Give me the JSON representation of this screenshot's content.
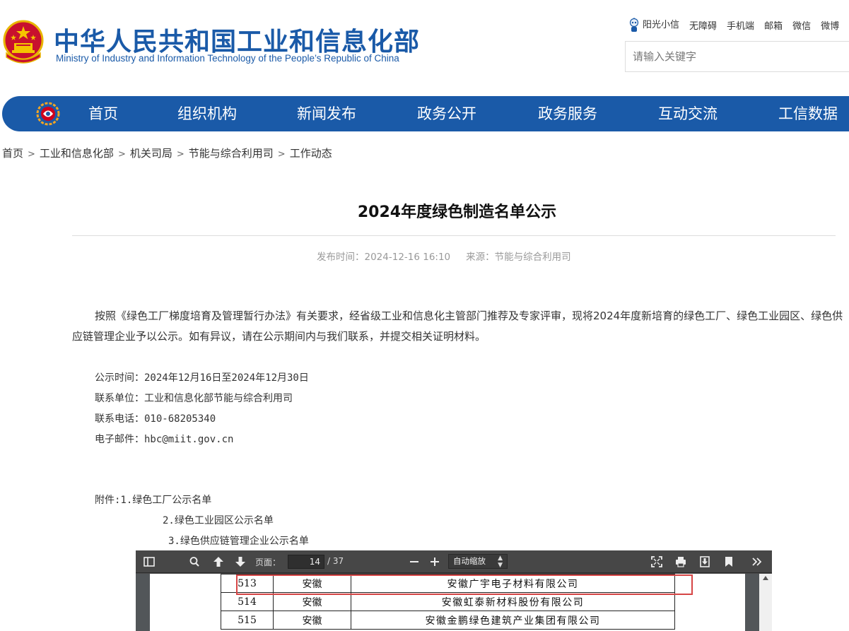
{
  "header": {
    "title": "中华人民共和国工业和信息化部",
    "subtitle": "Ministry of Industry and Information Technology of the People’s Republic of China",
    "top_links": [
      "阳光小信",
      "无障碍",
      "手机端",
      "邮箱",
      "微信",
      "微博"
    ],
    "search_placeholder": "请输入关键字"
  },
  "nav": {
    "items": [
      "首页",
      "组织机构",
      "新闻发布",
      "政务公开",
      "政务服务",
      "互动交流",
      "工信数据"
    ]
  },
  "breadcrumb": [
    "首页",
    "工业和信息化部",
    "机关司局",
    "节能与综合利用司",
    "工作动态"
  ],
  "article": {
    "title": "2024年度绿色制造名单公示",
    "publish_label": "发布时间：2024-12-16 16:10",
    "source_label": "来源：节能与综合利用司",
    "intro": "按照《绿色工厂梯度培育及管理暂行办法》有关要求，经省级工业和信息化主管部门推荐及专家评审，现将2024年度新培育的绿色工厂、绿色工业园区、绿色供应链管理企业予以公示。如有异议，请在公示期间内与我们联系，并提交相关证明材料。",
    "info": [
      "公示时间：2024年12月16日至2024年12月30日",
      "联系单位：工业和信息化部节能与综合利用司",
      "联系电话：010-68205340",
      "电子邮件：hbc@miit.gov.cn"
    ],
    "attachments": [
      "附件:1.绿色工厂公示名单",
      "2.绿色工业园区公示名单",
      "3.绿色供应链管理企业公示名单"
    ]
  },
  "pdf_viewer": {
    "page_label": "页面：",
    "current_page": "14",
    "total_pages": "/ 37",
    "zoom_value": "自动缩放",
    "rows": [
      {
        "num": "513",
        "province": "安徽",
        "company": "安徽广宇电子材料有限公司"
      },
      {
        "num": "514",
        "province": "安徽",
        "company": "安徽虹泰新材料股份有限公司"
      },
      {
        "num": "515",
        "province": "安徽",
        "company": "安徽金鹏绿色建筑产业集团有限公司"
      }
    ]
  }
}
